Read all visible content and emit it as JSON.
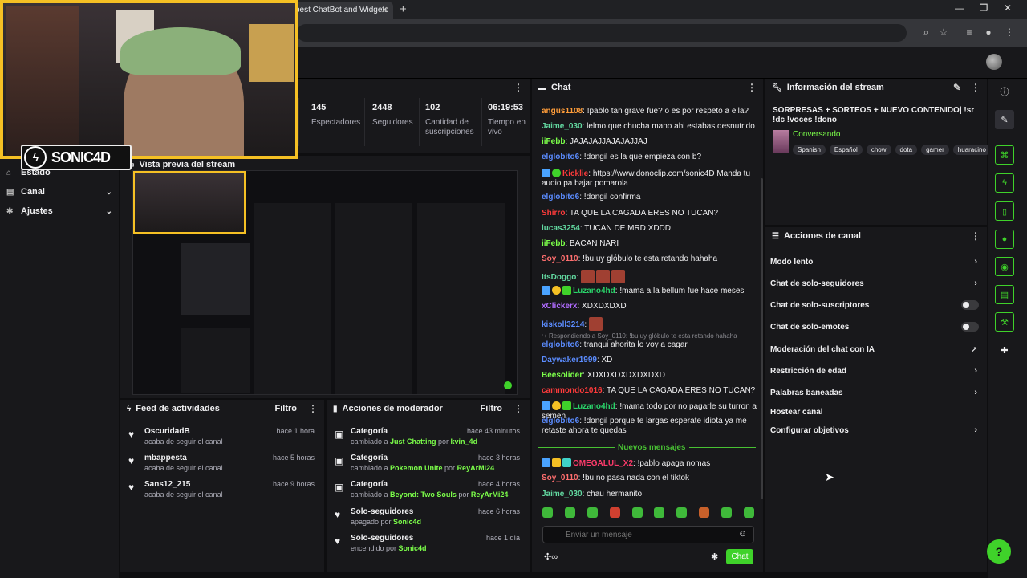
{
  "browser": {
    "tab_title": "best ChatBot and Widgets",
    "tab_close": "✕",
    "new_tab": "+",
    "window_controls": [
      "—",
      "❐",
      "✕"
    ]
  },
  "webcam": {
    "logo_text": "SONIC4D"
  },
  "nav": {
    "items": [
      {
        "label": "Estado",
        "icon": "home-icon"
      },
      {
        "label": "Canal",
        "icon": "gear-icon"
      },
      {
        "label": "Ajustes",
        "icon": "gear-icon"
      }
    ]
  },
  "stats": [
    {
      "value": "145",
      "label": "Espectadores"
    },
    {
      "value": "2448",
      "label": "Seguidores"
    },
    {
      "value": "102",
      "label": "Cantidad de suscripciones"
    },
    {
      "value": "06:19:53",
      "label": "Tiempo en vivo"
    }
  ],
  "preview": {
    "title": "Vista previa del stream"
  },
  "feed": {
    "title": "Feed de actividades",
    "filter": "Filtro",
    "items": [
      {
        "name": "OscuridadB",
        "sub": "acaba de seguir el canal",
        "time": "hace 1 hora"
      },
      {
        "name": "mbappesta",
        "sub": "acaba de seguir el canal",
        "time": "hace 5 horas"
      },
      {
        "name": "Sans12_215",
        "sub": "acaba de seguir el canal",
        "time": "hace 9 horas"
      }
    ]
  },
  "mod": {
    "title": "Acciones de moderador",
    "filter": "Filtro",
    "items": [
      {
        "name": "Categoría",
        "pre": "cambiado a ",
        "hl": "Just Chatting",
        "mid": " por ",
        "user": "kvin_4d",
        "time": "hace 43 minutos",
        "icon": "category-icon"
      },
      {
        "name": "Categoría",
        "pre": "cambiado a ",
        "hl": "Pokemon Unite",
        "mid": " por ",
        "user": "ReyArMi24",
        "time": "hace 3 horas",
        "icon": "category-icon"
      },
      {
        "name": "Categoría",
        "pre": "cambiado a ",
        "hl": "Beyond: Two Souls",
        "mid": " por ",
        "user": "ReyArMi24",
        "time": "hace 4 horas",
        "icon": "category-icon"
      },
      {
        "name": "Solo-seguidores",
        "pre": "apagado por ",
        "hl": "",
        "mid": "",
        "user": "Sonic4d",
        "time": "hace 6 horas",
        "icon": "heart-icon"
      },
      {
        "name": "Solo-seguidores",
        "pre": "encendido por ",
        "hl": "",
        "mid": "",
        "user": "Sonic4d",
        "time": "hace 1 día",
        "icon": "heart-icon"
      }
    ]
  },
  "chat": {
    "title": "Chat",
    "new_messages": "Nuevos mensajes",
    "input_placeholder": "Enviar un mensaje",
    "send_label": "Chat",
    "messages": [
      {
        "user": "angus1108",
        "color": "#ff9d3a",
        "text": "!pablo tan grave fue? o es por respeto a ella?"
      },
      {
        "user": "Jaime_030",
        "color": "#62d8a0",
        "text": "lelmo que chucha mano ahi estabas desnutrido"
      },
      {
        "user": "iiFebb",
        "color": "#7cff4a",
        "text": "JAJAJAJJAJAJAJJAJ"
      },
      {
        "user": "elglobito6",
        "color": "#5b8cff",
        "text": "!dongil es la que empieza con b?"
      },
      {
        "user": "Kicklie",
        "color": "#ff3b3b",
        "text": "https://www.donoclip.com/sonic4D Manda tu audio pa bajar pomarola"
      },
      {
        "user": "elglobito6",
        "color": "#5b8cff",
        "text": "!dongil confirma"
      },
      {
        "user": "Shirro",
        "color": "#ff3b3b",
        "text": "TA QUE LA CAGADA ERES NO TUCAN?"
      },
      {
        "user": "lucas3254",
        "color": "#62d8a0",
        "text": "TUCAN DE MRD XDDD"
      },
      {
        "user": "iiFebb",
        "color": "#7cff4a",
        "text": "BACAN NARI"
      },
      {
        "user": "Soy_0110",
        "color": "#ff6f6f",
        "text": "!bu uy glóbulo te esta retando hahaha"
      },
      {
        "user": "ItsDoggo",
        "color": "#62d8a0",
        "text": ""
      },
      {
        "user": "Luzano4hd",
        "color": "#2ad46a",
        "text": "!mama a la bellum fue hace meses"
      },
      {
        "user": "xClickerx",
        "color": "#b06bff",
        "text": "XDXDXDXD"
      },
      {
        "user": "kiskoll3214",
        "color": "#5b8cff",
        "text": ""
      },
      {
        "user": "",
        "color": "#8a8a90",
        "text": "Respondiendo a Soy_0110: !bu uy glóbulo te esta retando hahaha"
      },
      {
        "user": "elglobito6",
        "color": "#5b8cff",
        "text": "tranqui ahorita lo voy a cagar"
      },
      {
        "user": "Daywaker1999",
        "color": "#5b8cff",
        "text": "XD"
      },
      {
        "user": "Beesolider",
        "color": "#7cff4a",
        "text": "XDXDXDXDXDXDXD"
      },
      {
        "user": "cammondo1016",
        "color": "#ff3b3b",
        "text": "TA QUE LA CAGADA ERES NO TUCAN?"
      },
      {
        "user": "Luzano4hd",
        "color": "#2ad46a",
        "text": "!mama todo por no pagarle su turron a semen"
      },
      {
        "user": "elglobito6",
        "color": "#5b8cff",
        "text": "!dongil porque te largas esperate idiota ya me retaste ahora te quedas"
      },
      {
        "user": "OMEGALUL_X2",
        "color": "#ff3b6b",
        "text": "!pablo apaga nomas"
      },
      {
        "user": "Soy_0110",
        "color": "#ff6f6f",
        "text": "!bu no pasa nada con el tiktok"
      },
      {
        "user": "Jaime_030",
        "color": "#62d8a0",
        "text": "chau hermanito"
      }
    ]
  },
  "info": {
    "title": "Información del stream",
    "stream_title": "SORPRESAS + SORTEOS + NUEVO CONTENIDO| !sr !dc !voces !dono",
    "category": "Conversando",
    "tags": [
      "Spanish",
      "Español",
      "chow",
      "dota",
      "gamer",
      "huaracino"
    ]
  },
  "acciones": {
    "title": "Acciones de canal",
    "items": [
      {
        "label": "Modo lento",
        "control": "chevron"
      },
      {
        "label": "Chat de solo-seguidores",
        "control": "chevron"
      },
      {
        "label": "Chat de solo-suscriptores",
        "control": "toggle"
      },
      {
        "label": "Chat de solo-emotes",
        "control": "toggle"
      },
      {
        "label": "Moderación del chat con IA",
        "control": "external"
      },
      {
        "label": "Restricción de edad",
        "control": "chevron"
      },
      {
        "label": "Palabras baneadas",
        "control": "chevron"
      },
      {
        "label": "Hostear canal",
        "control": "none"
      },
      {
        "label": "Configurar objetivos",
        "control": "chevron"
      }
    ]
  },
  "colors": {
    "accent": "#3fd22a",
    "webcam_border": "#f5c024",
    "bg": "#0e0e10",
    "panel": "#18181b"
  }
}
